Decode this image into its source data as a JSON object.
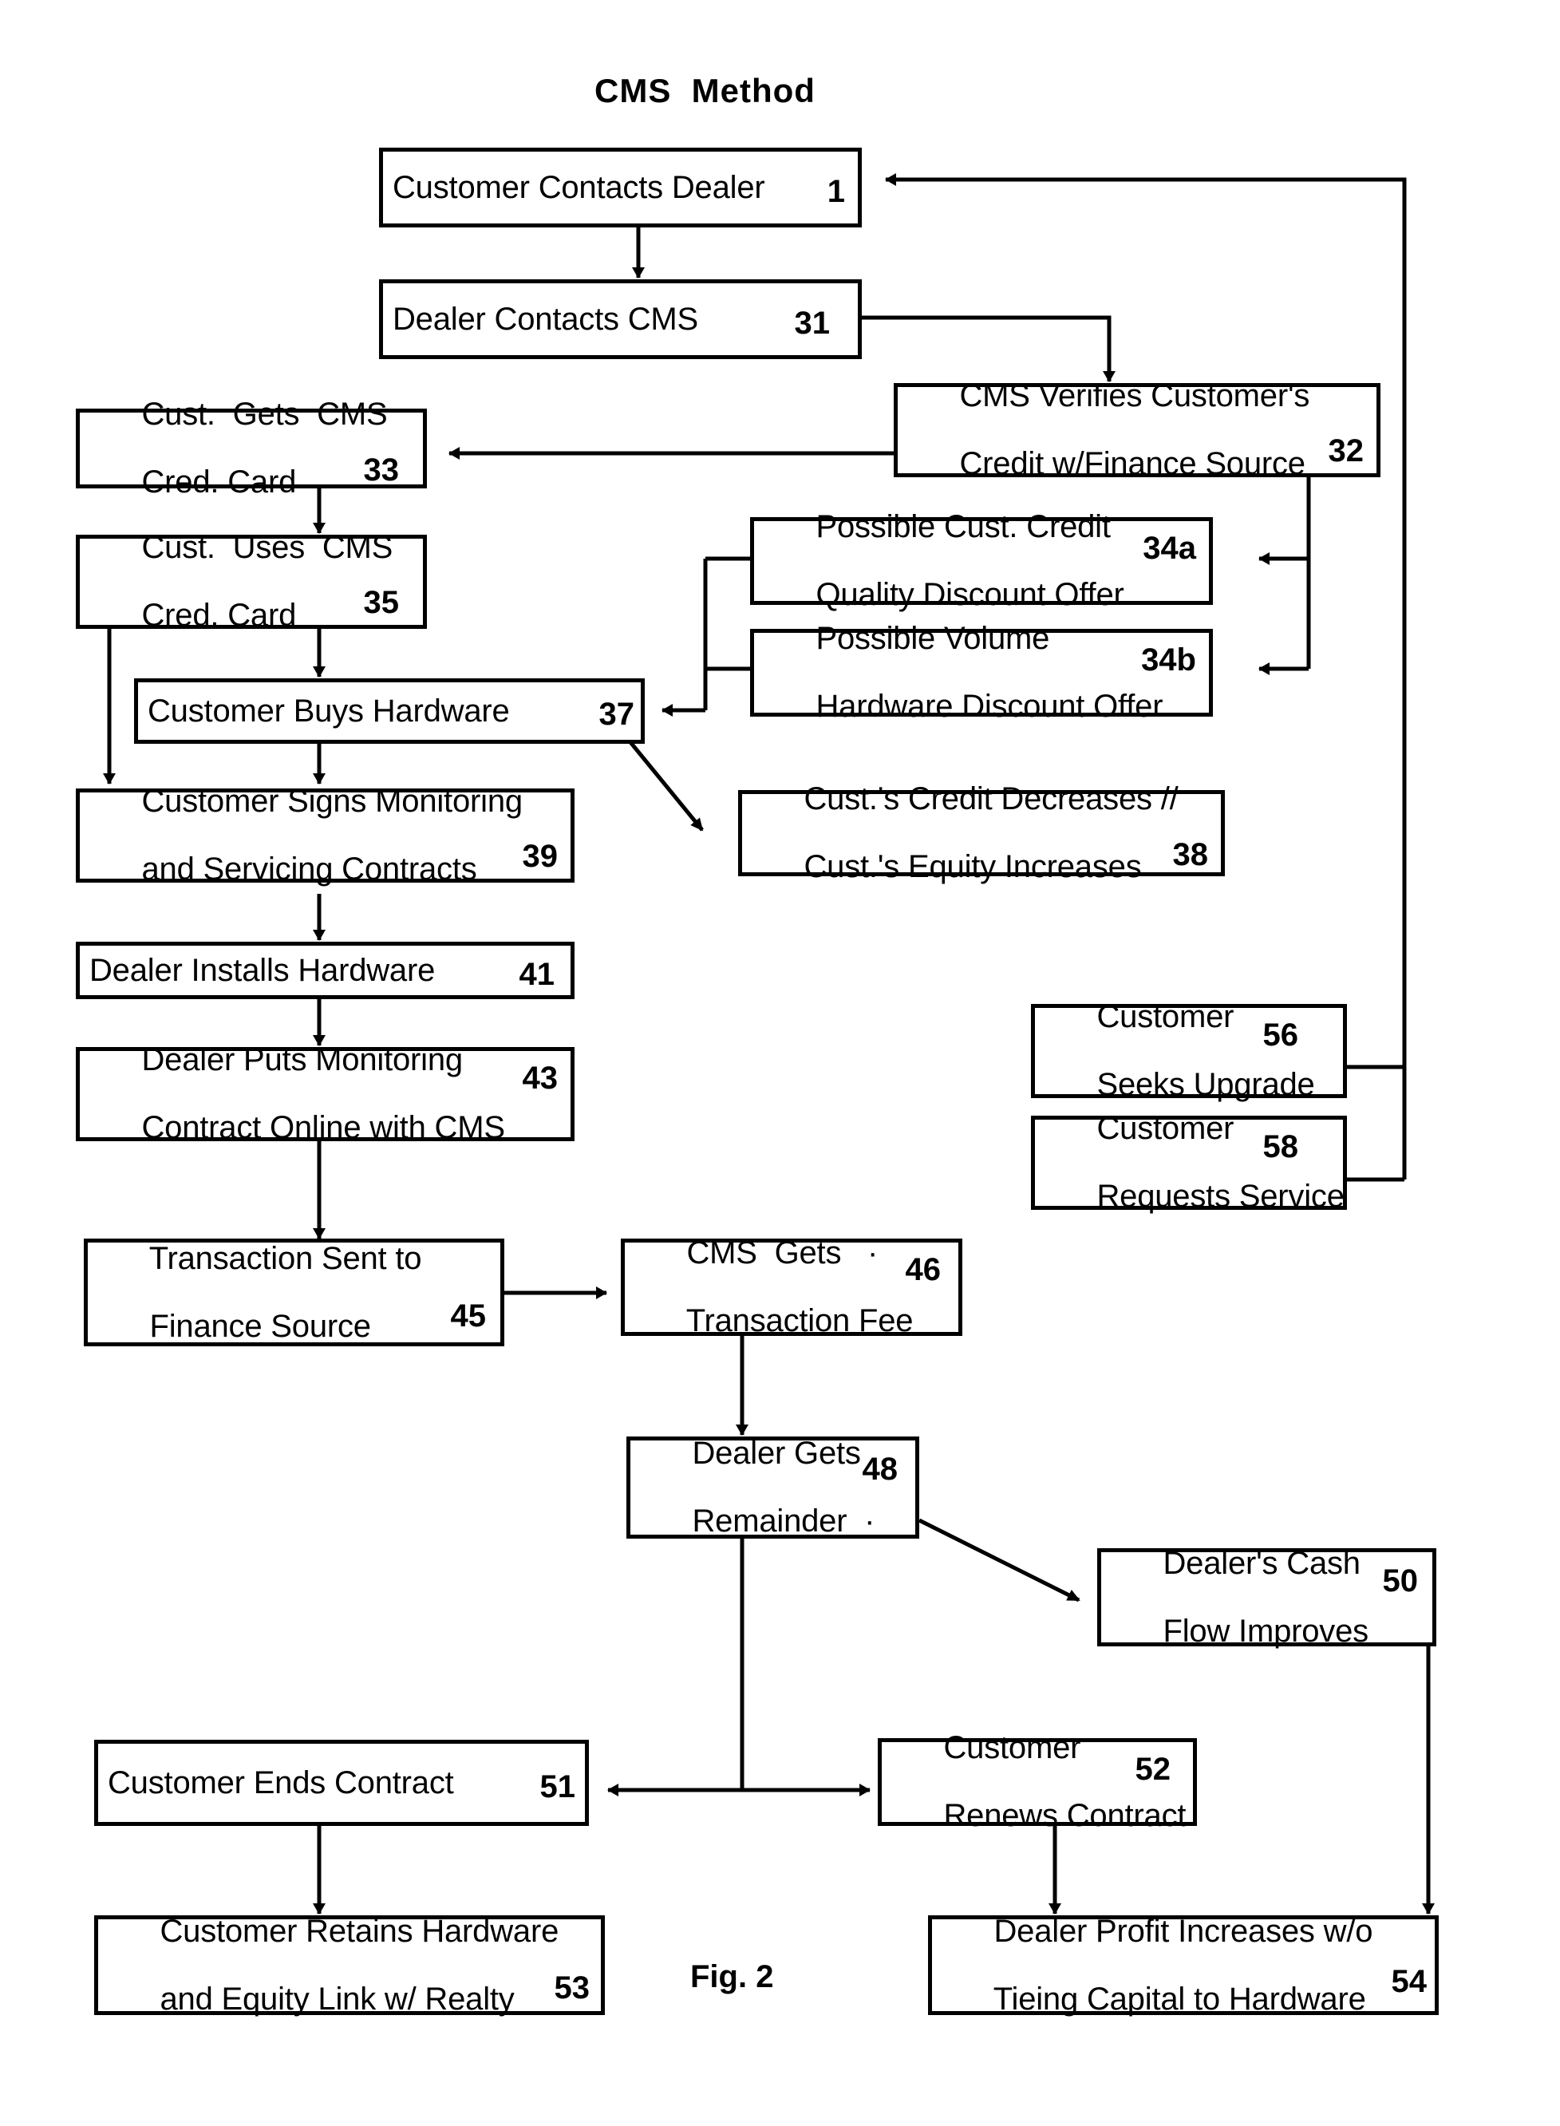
{
  "figure": {
    "title": "CMS  Method",
    "caption": "Fig. 2",
    "type": "flowchart",
    "ink_color": "#000000",
    "background_color": "#ffffff"
  },
  "nodes": [
    {
      "id": "n1",
      "ref": "1",
      "lines": [
        "Customer Contacts Dealer"
      ]
    },
    {
      "id": "n31",
      "ref": "31",
      "lines": [
        "Dealer Contacts CMS"
      ]
    },
    {
      "id": "n32",
      "ref": "32",
      "lines": [
        "CMS Verifies Customer's",
        "Credit w/Finance Source"
      ]
    },
    {
      "id": "n33",
      "ref": "33",
      "lines": [
        "Cust.  Gets  CMS",
        "Cred. Card"
      ]
    },
    {
      "id": "n34a",
      "ref": "34a",
      "lines": [
        "Possible Cust. Credit",
        "Quality Discount Offer"
      ]
    },
    {
      "id": "n34b",
      "ref": "34b",
      "lines": [
        "Possible Volume",
        "Hardware Discount Offer"
      ]
    },
    {
      "id": "n35",
      "ref": "35",
      "lines": [
        "Cust.  Uses  CMS",
        "Cred. Card"
      ]
    },
    {
      "id": "n37",
      "ref": "37",
      "lines": [
        "Customer Buys Hardware"
      ]
    },
    {
      "id": "n38",
      "ref": "38",
      "lines": [
        "Cust.'s Credit Decreases //",
        "Cust.'s Equity Increases"
      ]
    },
    {
      "id": "n39",
      "ref": "39",
      "lines": [
        "Customer Signs Monitoring",
        "and Servicing Contracts"
      ]
    },
    {
      "id": "n41",
      "ref": "41",
      "lines": [
        "Dealer Installs Hardware"
      ]
    },
    {
      "id": "n43",
      "ref": "43",
      "lines": [
        "Dealer Puts Monitoring",
        "Contract Online with CMS"
      ]
    },
    {
      "id": "n45",
      "ref": "45",
      "lines": [
        "Transaction Sent to",
        "Finance Source"
      ]
    },
    {
      "id": "n46",
      "ref": "46",
      "lines": [
        "CMS  Gets   ·",
        "Transaction Fee"
      ]
    },
    {
      "id": "n48",
      "ref": "48",
      "lines": [
        "Dealer Gets",
        "Remainder  ·"
      ]
    },
    {
      "id": "n50",
      "ref": "50",
      "lines": [
        "Dealer's Cash",
        "Flow Improves"
      ]
    },
    {
      "id": "n51",
      "ref": "51",
      "lines": [
        "Customer Ends Contract"
      ]
    },
    {
      "id": "n52",
      "ref": "52",
      "lines": [
        "Customer",
        "Renews Contract"
      ]
    },
    {
      "id": "n53",
      "ref": "53",
      "lines": [
        "Customer Retains Hardware",
        "and Equity Link w/ Realty"
      ]
    },
    {
      "id": "n54",
      "ref": "54",
      "lines": [
        "Dealer Profit Increases w/o",
        "Tieing Capital to Hardware"
      ]
    },
    {
      "id": "n56",
      "ref": "56",
      "lines": [
        "Customer",
        "Seeks Upgrade"
      ]
    },
    {
      "id": "n58",
      "ref": "58",
      "lines": [
        "Customer",
        "Requests Service"
      ]
    }
  ],
  "edges": [
    {
      "from": "1",
      "to": "31",
      "style": "arrow-down"
    },
    {
      "from": "31",
      "to": "32",
      "style": "elbow-right-down"
    },
    {
      "from": "32",
      "to": "33",
      "style": "arrow-left"
    },
    {
      "from": "32",
      "to": "34a",
      "style": "elbow-down-left"
    },
    {
      "from": "32",
      "to": "34b",
      "style": "elbow-down-left"
    },
    {
      "from": "33",
      "to": "35",
      "style": "arrow-down"
    },
    {
      "from": "35",
      "to": "37",
      "style": "arrow-down"
    },
    {
      "from": "35",
      "to": "39",
      "style": "arrow-down-left-branch"
    },
    {
      "from": "34a",
      "to": "37",
      "style": "elbow-left-down"
    },
    {
      "from": "34b",
      "to": "37",
      "style": "elbow-left-down"
    },
    {
      "from": "37",
      "to": "38",
      "style": "diagonal-arrow"
    },
    {
      "from": "37",
      "to": "39",
      "style": "arrow-down"
    },
    {
      "from": "39",
      "to": "41",
      "style": "arrow-down"
    },
    {
      "from": "41",
      "to": "43",
      "style": "arrow-down"
    },
    {
      "from": "43",
      "to": "45",
      "style": "arrow-down"
    },
    {
      "from": "45",
      "to": "46",
      "style": "arrow-right"
    },
    {
      "from": "46",
      "to": "48",
      "style": "arrow-down"
    },
    {
      "from": "48",
      "to": "50",
      "style": "diagonal-arrow"
    },
    {
      "from": "48",
      "to": "51",
      "style": "arrow-left"
    },
    {
      "from": "48",
      "to": "52",
      "style": "arrow-right"
    },
    {
      "from": "51",
      "to": "53",
      "style": "arrow-down"
    },
    {
      "from": "52",
      "to": "54",
      "style": "arrow-down"
    },
    {
      "from": "50",
      "to": "54",
      "style": "arrow-down"
    },
    {
      "from": "56",
      "to": "1",
      "style": "return-right-up"
    },
    {
      "from": "58",
      "to": "1",
      "style": "return-right-up"
    }
  ]
}
